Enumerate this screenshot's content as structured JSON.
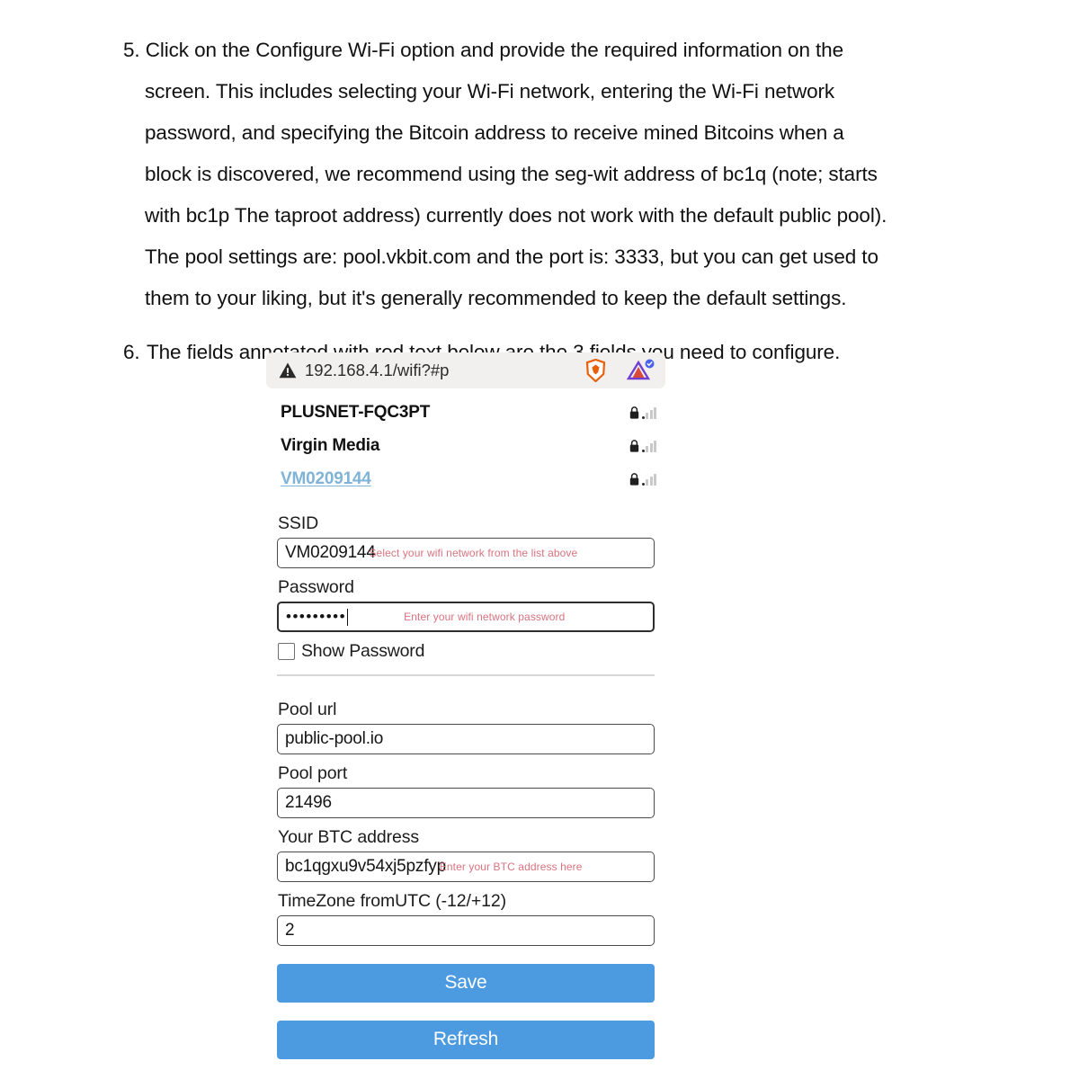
{
  "document": {
    "step5": "5. Click on the Configure Wi-Fi option and provide the required information on the screen. This includes selecting your Wi-Fi network, entering the Wi-Fi network password, and specifying the Bitcoin address to receive mined Bitcoins when a block is discovered, we recommend using the seg-wit address of bc1q (note; starts with bc1p The taproot address) currently does not work with the default public pool). The pool settings are: pool.vkbit.com and the port is: 3333, but you can get used to them to your liking, but it's generally recommended to keep the default settings.",
    "step6_number": "6.",
    "step6_text": "The fields annotated with red text below are the 3 fields you need to configure."
  },
  "screenshot": {
    "browser": {
      "url": "192.168.4.1/wifi?#p",
      "security_icon": "warning-triangle-icon",
      "brave_icon": "brave-shield-icon",
      "extension_icon": "extension-icon"
    },
    "networks": [
      {
        "ssid": "PLUSNET-FQC3PT",
        "selected": false,
        "secured": true
      },
      {
        "ssid": "Virgin Media",
        "selected": false,
        "secured": true
      },
      {
        "ssid": "VM0209144",
        "selected": true,
        "secured": true
      }
    ],
    "form": {
      "ssid": {
        "label": "SSID",
        "value": "VM0209144",
        "annotation": "Select your wifi network from the list above"
      },
      "password": {
        "label": "Password",
        "value": "•••••••••",
        "annotation": "Enter your wifi network password"
      },
      "show_password": {
        "label": "Show Password",
        "checked": false
      },
      "pool_url": {
        "label": "Pool url",
        "value": "public-pool.io"
      },
      "pool_port": {
        "label": "Pool port",
        "value": "21496"
      },
      "btc_address": {
        "label": "Your BTC address",
        "value": "bc1qgxu9v54xj5pzfyp",
        "annotation": "Enter your BTC address here"
      },
      "timezone": {
        "label": "TimeZone fromUTC (-12/+12)",
        "value": "2"
      }
    },
    "buttons": {
      "save": "Save",
      "refresh": "Refresh"
    },
    "colors": {
      "button_blue": "#4c9be0",
      "annotation_red": "#d8737f",
      "link_blue": "#7fb3d8",
      "urlbar_bg": "#f2f0ee"
    }
  }
}
